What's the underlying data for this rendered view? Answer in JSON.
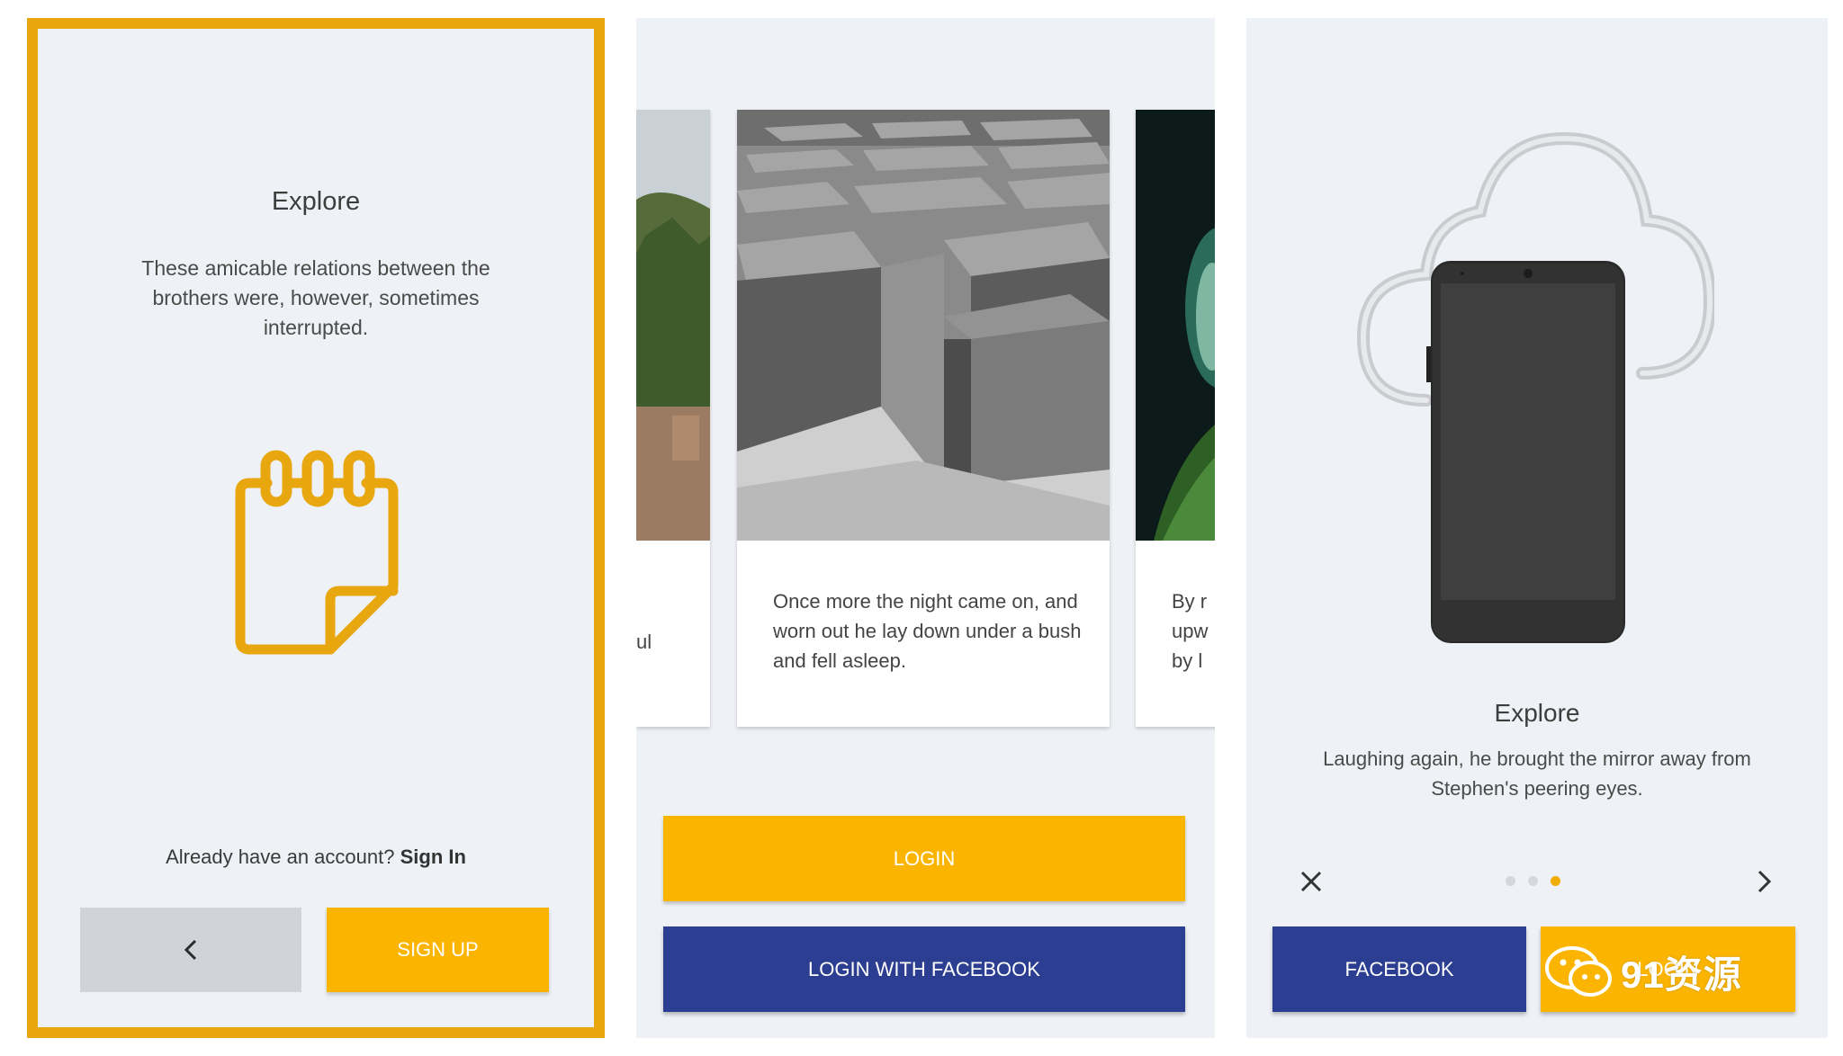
{
  "screen1": {
    "title": "Explore",
    "description": "These amicable relations between the brothers were, however, sometimes interrupted.",
    "account_prompt": "Already have an account?",
    "sign_in_link": "Sign In",
    "signup_label": "SIGN UP",
    "icon": "notepad-icon",
    "accent_color": "#e8a60f"
  },
  "screen2": {
    "cards": [
      {
        "text": "ul",
        "image": "forest-riverbank-photo"
      },
      {
        "text": "Once more the night came on, and worn out he lay down under a bush and fell asleep.",
        "image": "concrete-blocks-photo"
      },
      {
        "text_lines": [
          "By r",
          "upw",
          "by l"
        ],
        "image": "green-leaves-photo"
      }
    ],
    "login_label": "LOGIN",
    "facebook_label": "LOGIN WITH FACEBOOK",
    "primary_color": "#fbb500",
    "facebook_color": "#2c3e91"
  },
  "screen3": {
    "title": "Explore",
    "description": "Laughing again, he brought the mirror away from Stephen's peering eyes.",
    "illustration": "phone-cloud-illustration",
    "pager": {
      "count": 3,
      "active": 3
    },
    "facebook_label": "FACEBOOK",
    "login_label": "LOGIN",
    "watermark": "91资源"
  }
}
